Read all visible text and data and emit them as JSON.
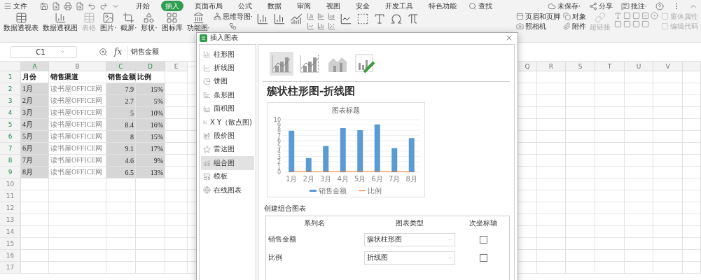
{
  "menu_bar": {
    "file": "文件",
    "tabs": [
      {
        "label": "开始",
        "selected": false
      },
      {
        "label": "插入",
        "selected": true
      },
      {
        "label": "页面布局",
        "selected": false
      },
      {
        "label": "公式",
        "selected": false
      },
      {
        "label": "数据",
        "selected": false
      },
      {
        "label": "审阅",
        "selected": false
      },
      {
        "label": "视图",
        "selected": false
      },
      {
        "label": "安全",
        "selected": false
      },
      {
        "label": "开发工具",
        "selected": false
      },
      {
        "label": "特色功能",
        "selected": false
      }
    ],
    "search": "查找",
    "save_status": "未保存·",
    "share": "分享",
    "comment": "批注·"
  },
  "ribbon": {
    "large": [
      {
        "label": "数据透视表",
        "disabled": false
      },
      {
        "label": "数据透视图",
        "disabled": false
      },
      {
        "label": "表格",
        "disabled": true
      },
      {
        "label": "图片·",
        "disabled": false
      },
      {
        "label": "截屏·",
        "disabled": false
      },
      {
        "label": "形状·",
        "disabled": false
      },
      {
        "label": "图标库",
        "disabled": false
      },
      {
        "label": "功能图·",
        "disabled": false
      }
    ],
    "mind_map": "思维导图·",
    "tools": [
      {
        "label": "页眉和页脚",
        "disabled": false
      },
      {
        "label": "照相机",
        "disabled": false
      },
      {
        "label": "对象",
        "disabled": false
      },
      {
        "label": "附件",
        "disabled": false
      }
    ],
    "hyperlink": {
      "label": "超链接",
      "disabled": true
    },
    "form_tools": [
      {
        "label": "窗体属性",
        "disabled": true
      },
      {
        "label": "编辑代码",
        "disabled": true
      }
    ]
  },
  "formula_bar": {
    "name_box": "C1",
    "fx_label": "fx",
    "value": "销售金额"
  },
  "sheet": {
    "columns": [
      {
        "label": "A",
        "selected": true
      },
      {
        "label": "B",
        "selected": false
      },
      {
        "label": "C",
        "selected": true
      },
      {
        "label": "D",
        "selected": true
      },
      {
        "label": "E",
        "selected": false
      }
    ],
    "right_columns": [
      "Q",
      "R",
      "S",
      "T",
      "U",
      "V"
    ],
    "rows": [
      {
        "number": "1",
        "selected": true,
        "kind": "header",
        "cells": [
          "月份",
          "销售渠道",
          "销售金额",
          "比例"
        ]
      },
      {
        "number": "2",
        "selected": true,
        "kind": "data",
        "cells": [
          "1月",
          "读书屋OFFICE网",
          "7.9",
          "15%"
        ]
      },
      {
        "number": "3",
        "selected": true,
        "kind": "data",
        "cells": [
          "2月",
          "读书屋OFFICE网",
          "2.7",
          "5%"
        ]
      },
      {
        "number": "4",
        "selected": true,
        "kind": "data",
        "cells": [
          "3月",
          "读书屋OFFICE网",
          "5",
          "10%"
        ]
      },
      {
        "number": "5",
        "selected": true,
        "kind": "data",
        "cells": [
          "4月",
          "读书屋OFFICE网",
          "8.4",
          "16%"
        ]
      },
      {
        "number": "6",
        "selected": true,
        "kind": "data",
        "cells": [
          "5月",
          "读书屋OFFICE网",
          "8",
          "15%"
        ]
      },
      {
        "number": "7",
        "selected": true,
        "kind": "data",
        "cells": [
          "6月",
          "读书屋OFFICE网",
          "9.1",
          "17%"
        ]
      },
      {
        "number": "8",
        "selected": true,
        "kind": "data",
        "cells": [
          "7月",
          "读书屋OFFICE网",
          "4.6",
          "9%"
        ]
      },
      {
        "number": "9",
        "selected": true,
        "kind": "data",
        "cells": [
          "8月",
          "读书屋OFFICE网",
          "6.5",
          "13%"
        ]
      }
    ],
    "empty_rows": [
      "10",
      "11",
      "12",
      "13",
      "14",
      "15",
      "16",
      "17"
    ]
  },
  "dialog": {
    "title": "插入图表",
    "categories": [
      {
        "label": "柱形图",
        "selected": false
      },
      {
        "label": "折线图",
        "selected": false
      },
      {
        "label": "饼图",
        "selected": false
      },
      {
        "label": "条形图",
        "selected": false
      },
      {
        "label": "面积图",
        "selected": false
      },
      {
        "label": "X Y（散点图)",
        "selected": false
      },
      {
        "label": "股价图",
        "selected": false
      },
      {
        "label": "雷达图",
        "selected": false
      },
      {
        "label": "组合图",
        "selected": true
      },
      {
        "label": "模板",
        "selected": false
      },
      {
        "label": "在线图表",
        "selected": false
      }
    ],
    "thumbnails": [
      {
        "selected": true
      },
      {
        "selected": false
      },
      {
        "selected": false
      },
      {
        "selected": false
      }
    ],
    "heading": "簇状柱形图-折线图",
    "chart_data": {
      "type": "bar",
      "title": "图表标题",
      "categories": [
        "1月",
        "2月",
        "3月",
        "4月",
        "5月",
        "6月",
        "7月",
        "8月"
      ],
      "ylim": [
        0,
        10
      ],
      "grid": true,
      "legend": "bottom",
      "yticks": [
        0,
        1,
        2,
        3,
        4,
        5,
        6,
        7,
        8,
        9,
        10
      ],
      "series": [
        {
          "name": "销售金额",
          "type": "bar",
          "color": "#5b9bd5",
          "values": [
            7.9,
            2.7,
            5,
            8.4,
            8,
            9.1,
            4.6,
            6.5
          ]
        },
        {
          "name": "比例",
          "type": "line",
          "color": "#ed7d31",
          "values": [
            0.2,
            0.1,
            0.1,
            0.2,
            0.2,
            0.2,
            0.1,
            0.1
          ]
        }
      ]
    },
    "combo": {
      "title": "创建组合图表",
      "columns": [
        "系列名",
        "图表类型",
        "次坐标轴"
      ],
      "series": [
        {
          "name": "销售金额",
          "chart_type": "簇状柱形图",
          "secondary_axis": false
        },
        {
          "name": "比例",
          "chart_type": "折线图",
          "secondary_axis": false
        }
      ]
    }
  }
}
